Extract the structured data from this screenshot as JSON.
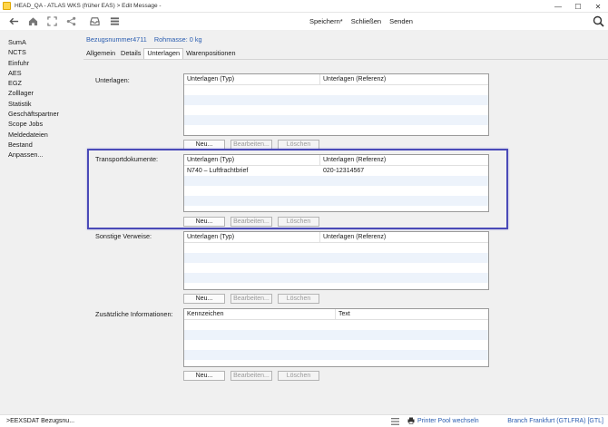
{
  "window": {
    "title": "HEAD_QA - ATLAS WKS (früher EAS) > Edit Message -",
    "controls": {
      "minimize": "—",
      "maximize": "☐",
      "close": "✕"
    }
  },
  "toolbar": {
    "icons": [
      "back-icon",
      "home-icon",
      "fullscreen-icon",
      "share-icon",
      "inbox-icon",
      "list-icon"
    ],
    "save_label": "Speichern*",
    "close_label": "Schließen",
    "send_label": "Senden"
  },
  "sidebar": {
    "items": [
      {
        "label": "SumA"
      },
      {
        "label": "NCTS"
      },
      {
        "label": "Einfuhr"
      },
      {
        "label": "AES"
      },
      {
        "label": "EGZ"
      },
      {
        "label": "Zolllager"
      },
      {
        "label": "Statistik"
      },
      {
        "label": "Geschäftspartner"
      },
      {
        "label": "Scope Jobs"
      },
      {
        "label": "Meldedateien"
      },
      {
        "label": "Bestand"
      },
      {
        "label": "Anpassen..."
      }
    ]
  },
  "header": {
    "ref_label": "Bezugsnummer4711",
    "mass_label": "Rohmasse: 0 kg"
  },
  "tabs": [
    {
      "label": "Allgemein"
    },
    {
      "label": "Details"
    },
    {
      "label": "Unterlagen"
    },
    {
      "label": "Warenpositionen"
    }
  ],
  "buttons": {
    "new": "Neu...",
    "edit": "Bearbeiten...",
    "delete": "Löschen"
  },
  "sections": {
    "unterlagen": {
      "label": "Unterlagen:",
      "columns": [
        "Unterlagen (Typ)",
        "Unterlagen (Referenz)"
      ],
      "rows": []
    },
    "transport": {
      "label": "Transportdokumente:",
      "columns": [
        "Unterlagen (Typ)",
        "Unterlagen (Referenz)"
      ],
      "rows": [
        {
          "typ": "N740 – Luftfrachtbrief",
          "ref": "020-12314567"
        }
      ]
    },
    "sonstige": {
      "label": "Sonstige Verweise:",
      "columns": [
        "Unterlagen (Typ)",
        "Unterlagen (Referenz)"
      ],
      "rows": []
    },
    "zusatz": {
      "label": "Zusätzliche Informationen:",
      "columns": [
        "Kennzeichen",
        "Text"
      ],
      "rows": []
    }
  },
  "statusbar": {
    "left_text": ">EEXSDAT Bezugsnu...",
    "printer_label": "Printer Pool wechseln",
    "branch_label": "Branch Frankfurt (GTLFRA) [GTL]"
  },
  "colors": {
    "link_blue": "#2a5db0",
    "highlight_border": "#4a4ab8",
    "alt_row": "#edf3fb"
  }
}
